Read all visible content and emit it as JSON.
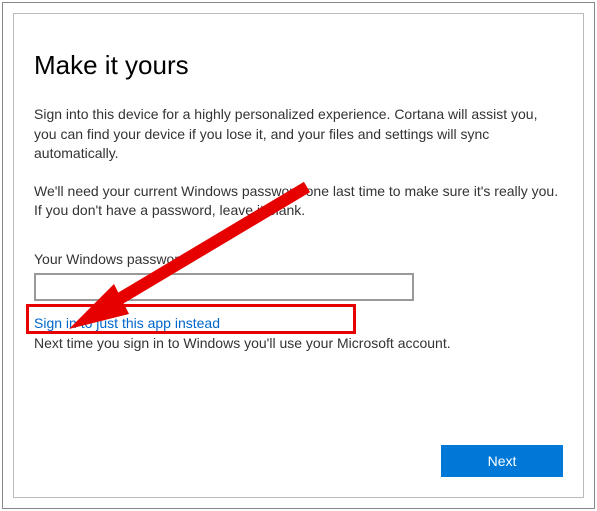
{
  "title": "Make it yours",
  "paragraph1": "Sign into this device for a highly personalized experience. Cortana will assist you, you can find your device if you lose it, and your files and settings will sync automatically.",
  "paragraph2": "We'll need your current Windows password one last time to make sure it's really you. If you don't have a password, leave it blank.",
  "passwordLabel": "Your Windows password",
  "passwordValue": "",
  "linkText": "Sign in to just this app instead",
  "infoText": "Next time you sign in to Windows you'll use your Microsoft account.",
  "nextButton": "Next",
  "annotation": {
    "boxColor": "#e60000",
    "arrowColor": "#e60000"
  }
}
